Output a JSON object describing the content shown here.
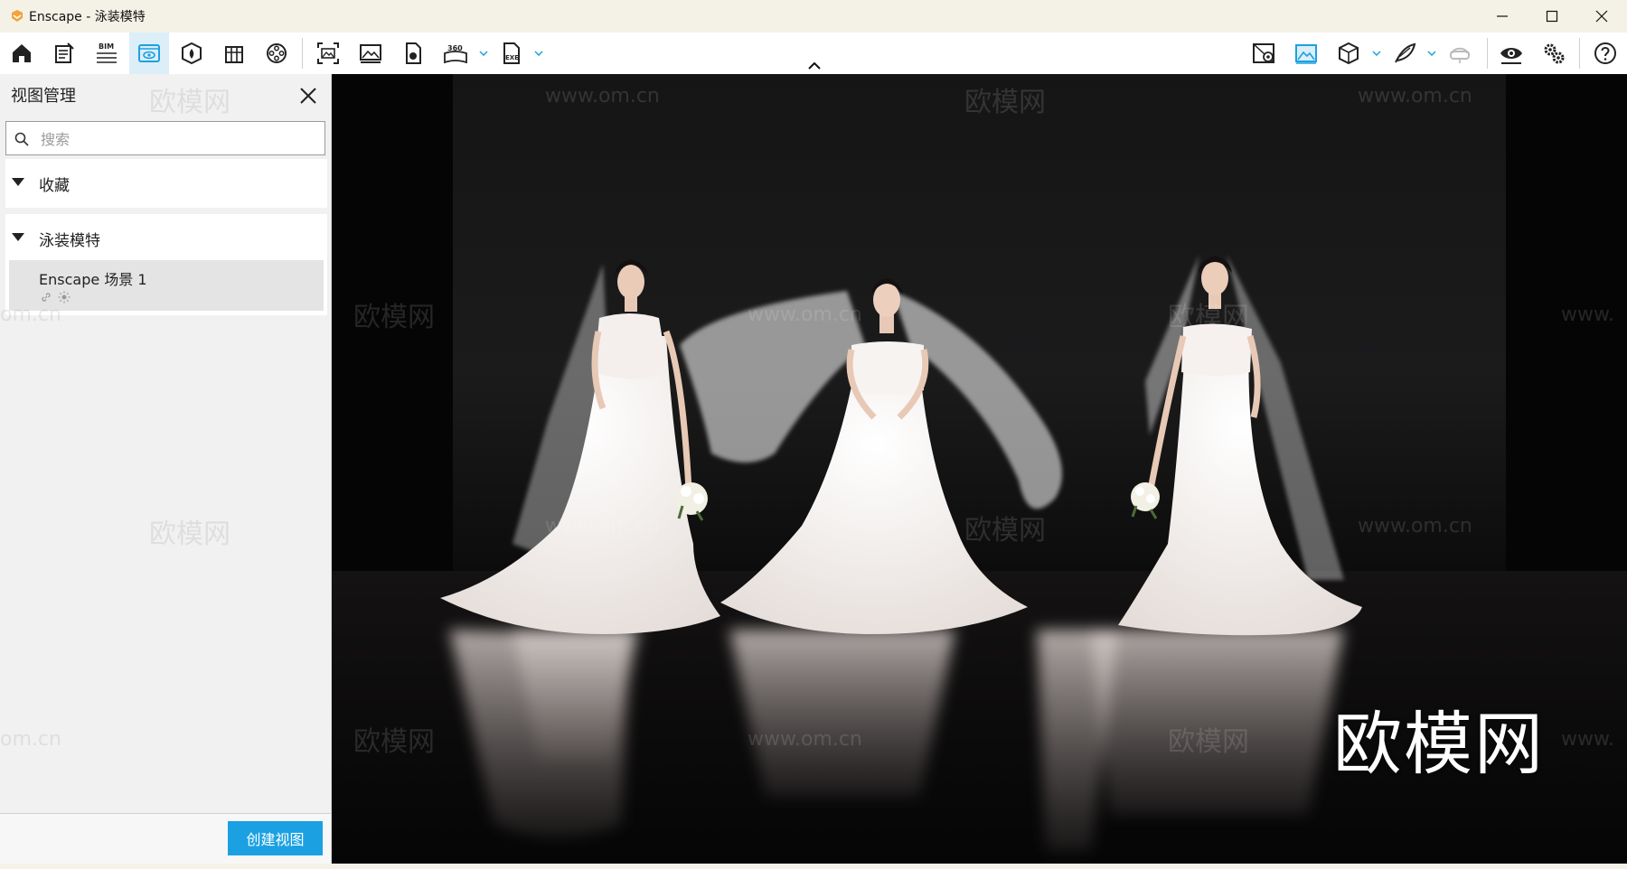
{
  "window": {
    "title": "Enscape - 泳装模特",
    "accent": "#1ba1e2",
    "logo_color": "#f2a33a"
  },
  "toolbar": {
    "left_icons": [
      "home-icon",
      "notes-icon",
      "bim-icon",
      "visual-settings-icon",
      "asset-library-icon",
      "building-icon",
      "video-reel-icon",
      "screenshot-icon",
      "image-export-icon",
      "panorama-upload-icon",
      "360-panorama-icon",
      "exe-export-icon"
    ],
    "bim_label": "BIM",
    "pano_label": "360",
    "exe_label": "EXE",
    "right_icons": [
      "map-pin-icon",
      "capture-view-icon",
      "cube-icon",
      "feather-icon",
      "vr-headset-icon",
      "eye-icon",
      "settings-gears-icon",
      "help-icon"
    ]
  },
  "panel": {
    "title": "视图管理",
    "search": {
      "placeholder": "搜索",
      "value": ""
    },
    "sections": [
      {
        "label": "收藏"
      },
      {
        "label": "泳装模特"
      }
    ],
    "views": [
      {
        "name": "Enscape 场景 1"
      }
    ],
    "create_button": "创建视图"
  },
  "viewport": {
    "watermark_text": "欧模网",
    "watermark_url": "www.om.cn",
    "brand_text": "欧模网",
    "partial_left_url": "om.cn",
    "partial_right_url": "www."
  }
}
